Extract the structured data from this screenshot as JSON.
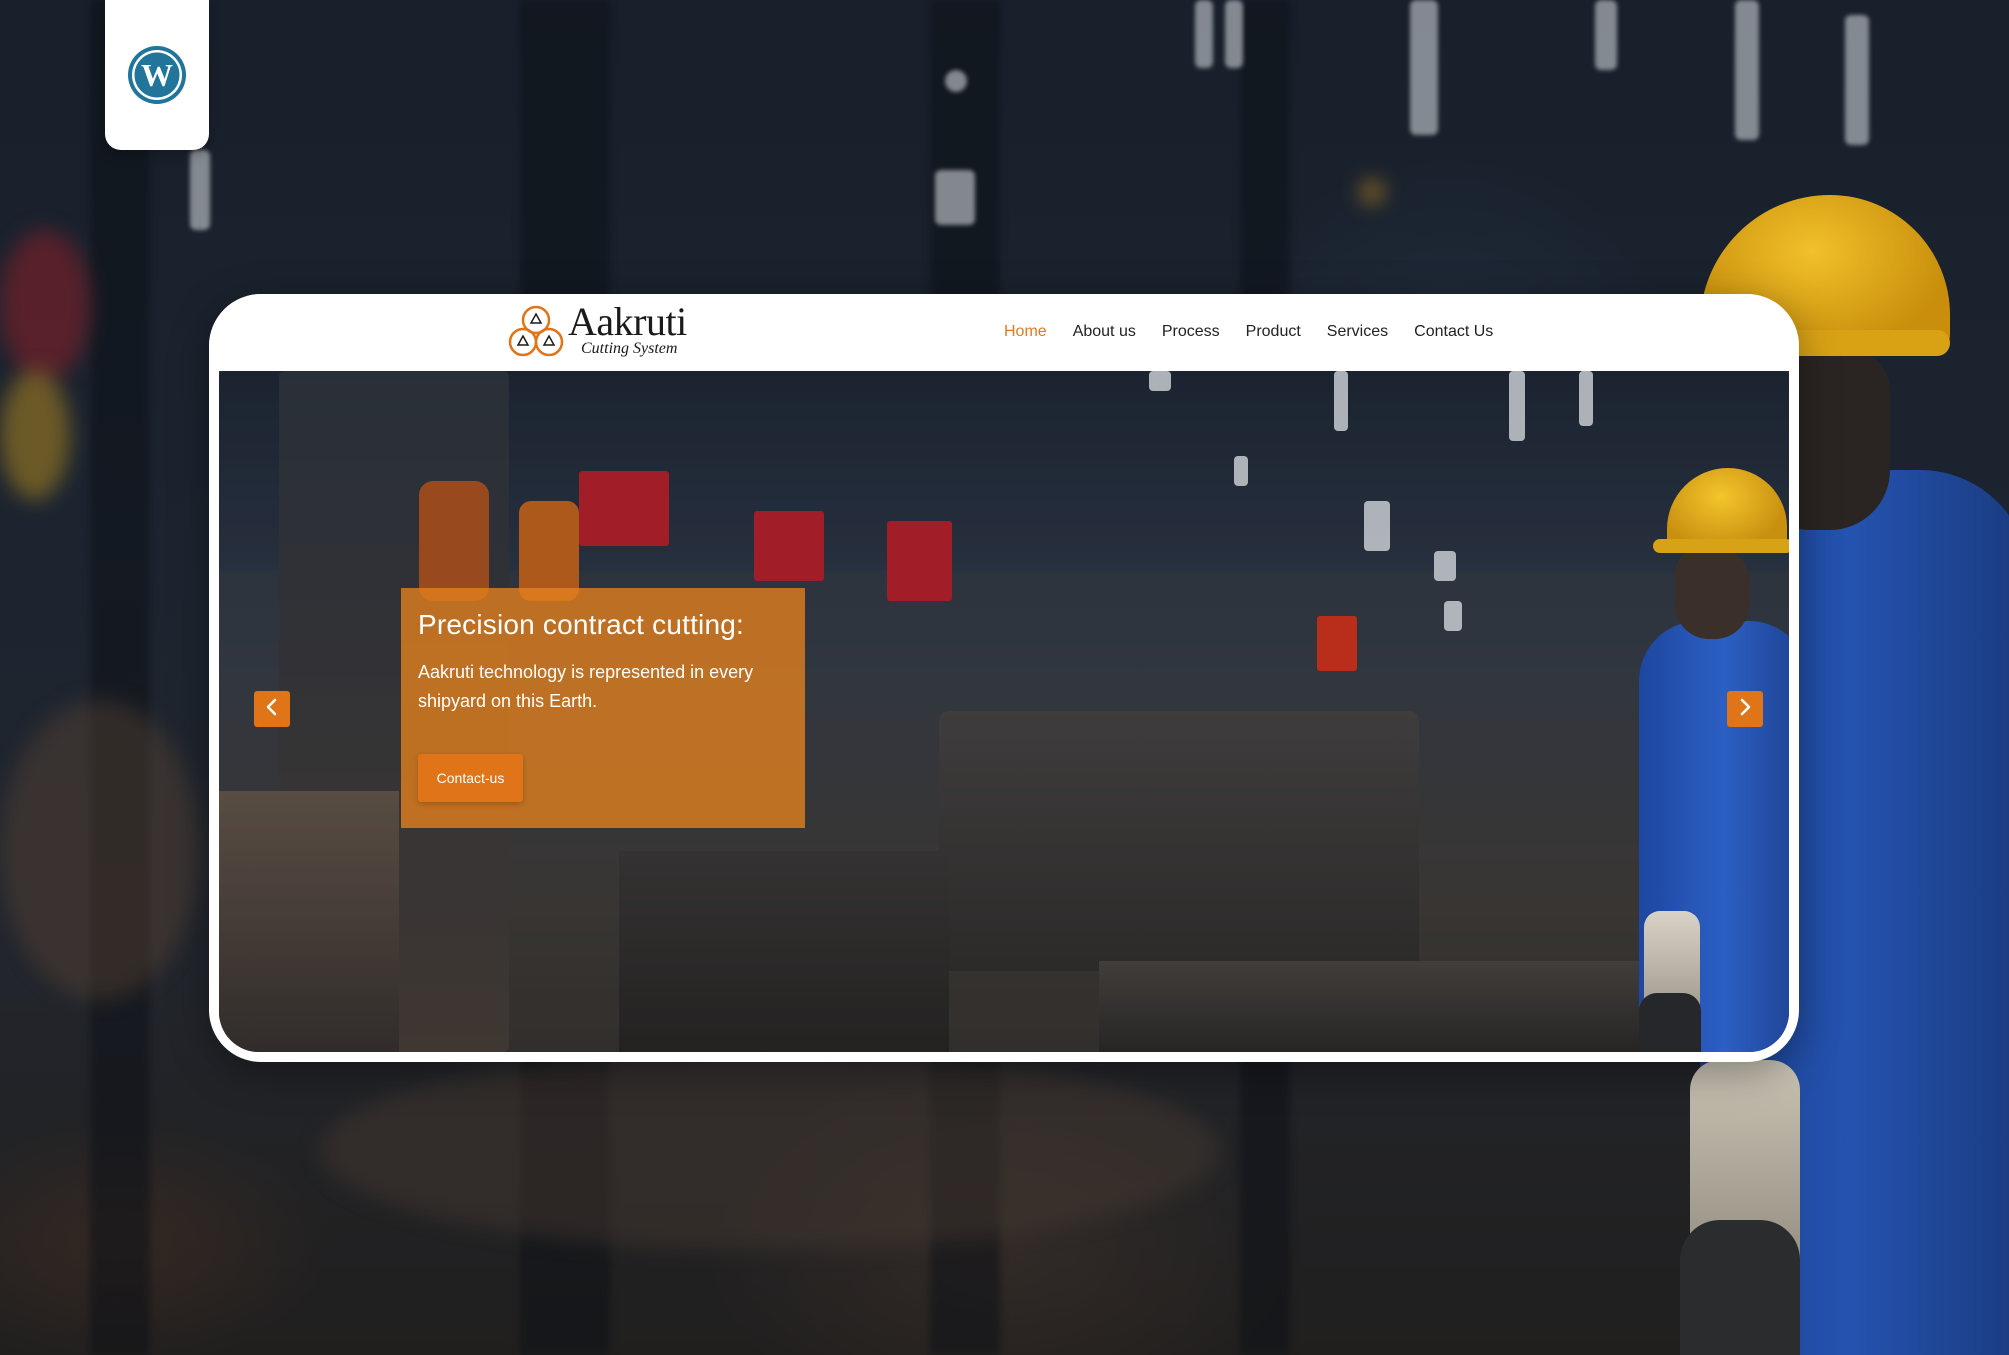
{
  "brand": {
    "name": "Aakruti",
    "tagline": "Cutting System",
    "accent_color": "#e07418",
    "logo_icon": "three-ring-triangle-logo"
  },
  "badge": {
    "icon": "wordpress-icon",
    "color": "#21759b"
  },
  "nav": {
    "items": [
      {
        "label": "Home",
        "active": true
      },
      {
        "label": "About us",
        "active": false
      },
      {
        "label": "Process",
        "active": false
      },
      {
        "label": "Product",
        "active": false
      },
      {
        "label": "Services",
        "active": false
      },
      {
        "label": "Contact Us",
        "active": false
      }
    ]
  },
  "hero": {
    "title": "Precision contract cutting:",
    "description": "Aakruti technology is represented in every shipyard on this Earth.",
    "cta_label": "Contact-us",
    "prev_icon": "chevron-left-icon",
    "next_icon": "chevron-right-icon"
  }
}
